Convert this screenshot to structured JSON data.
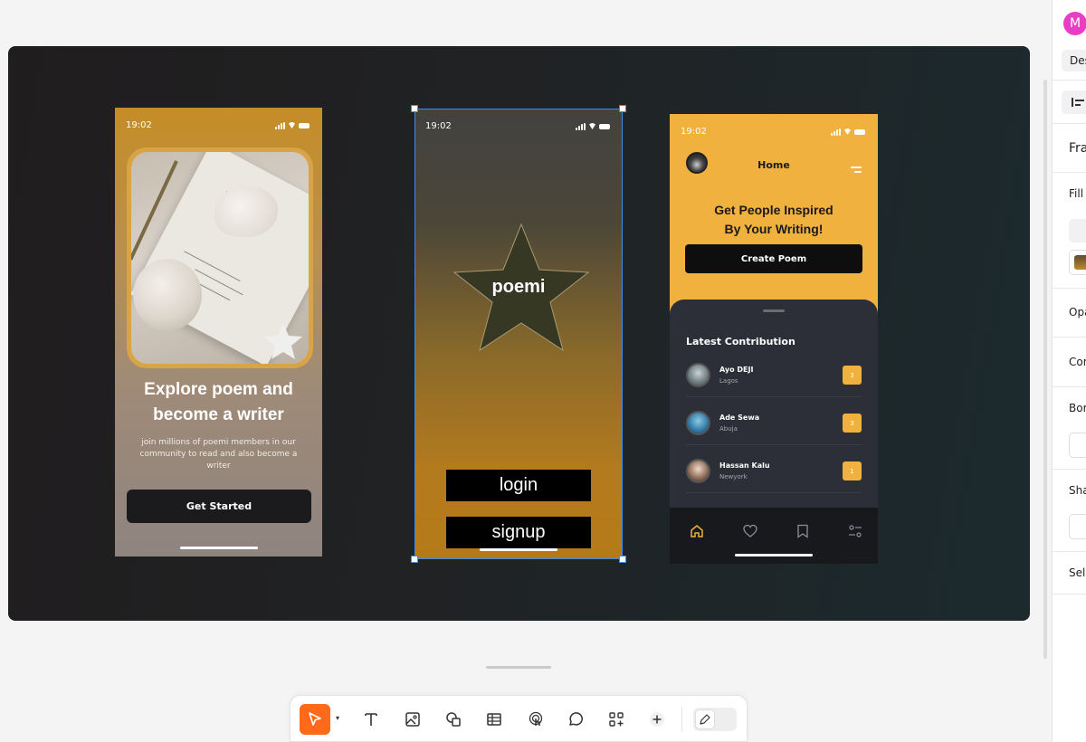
{
  "phones": {
    "onboarding": {
      "time": "19:02",
      "title": "Explore poem and become a writer",
      "subtitle": "join millions of poemi members in our community to read and also become a writer",
      "cta": "Get Started"
    },
    "splash": {
      "time": "19:02",
      "logo_text": "poemi",
      "login_label": "login",
      "signup_label": "signup"
    },
    "home": {
      "time": "19:02",
      "header_title": "Home",
      "headline": "Get People Inspired By Your Writing!",
      "create_label": "Create Poem",
      "section_title": "Latest Contribution",
      "contributions": [
        {
          "name": "Ayo DEJI",
          "location": "Lagos",
          "count": "3"
        },
        {
          "name": "Ade Sewa",
          "location": "Abuja",
          "count": "3"
        },
        {
          "name": "Hassan Kalu",
          "location": "Newyork",
          "count": "1"
        }
      ]
    }
  },
  "colors": {
    "accent_orange": "#ff6a1a",
    "selection_blue": "#3f8ce8",
    "poemi_yellow": "#f0b13e",
    "user_avatar_pink": "#e83ec6"
  },
  "toolbar": {
    "tools": [
      "select-icon",
      "text-icon",
      "image-icon",
      "shapes-icon",
      "table-icon",
      "interaction-icon",
      "comment-icon",
      "components-icon",
      "add-icon"
    ],
    "active_tool": "select-icon"
  },
  "right_panel": {
    "avatar_initial": "M",
    "tab_label": "Des",
    "frame_label": "Fra",
    "fill_label": "Fill",
    "opacity_label": "Opa",
    "corner_label": "Cor",
    "border_label": "Bor",
    "shadow_label": "Sha",
    "selection_label": "Sel"
  }
}
